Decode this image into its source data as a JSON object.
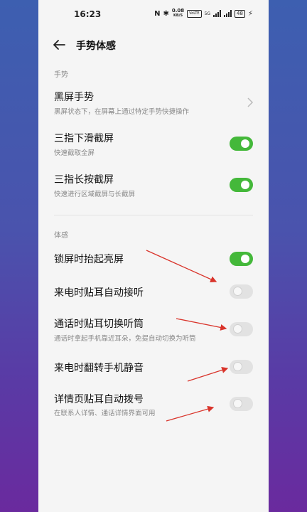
{
  "status_bar": {
    "time": "16:23",
    "speed_value": "0.08",
    "speed_unit": "KB/S",
    "volte": "VoLTE",
    "network": "5G",
    "battery": "48"
  },
  "header": {
    "title": "手势体感",
    "back_icon": "arrow-left-icon"
  },
  "sections": {
    "gesture": "手势",
    "motion": "体感"
  },
  "rows": [
    {
      "title": "黑屏手势",
      "subtitle": "黑屏状态下，在屏幕上通过特定手势快捷操作",
      "control": "chevron"
    },
    {
      "title": "三指下滑截屏",
      "subtitle": "快速截取全屏",
      "control": "toggle",
      "on": true
    },
    {
      "title": "三指长按截屏",
      "subtitle": "快速进行区域截屏与长截屏",
      "control": "toggle",
      "on": true
    },
    {
      "title": "锁屏时抬起亮屏",
      "subtitle": "",
      "control": "toggle",
      "on": true
    },
    {
      "title": "来电时贴耳自动接听",
      "subtitle": "",
      "control": "toggle",
      "on": false
    },
    {
      "title": "通话时贴耳切换听筒",
      "subtitle": "通话时拿起手机靠近耳朵，免提自动切换为听筒",
      "control": "toggle",
      "on": false
    },
    {
      "title": "来电时翻转手机静音",
      "subtitle": "",
      "control": "toggle",
      "on": false
    },
    {
      "title": "详情页贴耳自动拨号",
      "subtitle": "在联系人详情、通话详情界面可用",
      "control": "toggle",
      "on": false
    }
  ],
  "colors": {
    "toggle_on": "#44b83a",
    "toggle_off": "#e2e2e2",
    "annotation_arrow": "#d9342b"
  }
}
